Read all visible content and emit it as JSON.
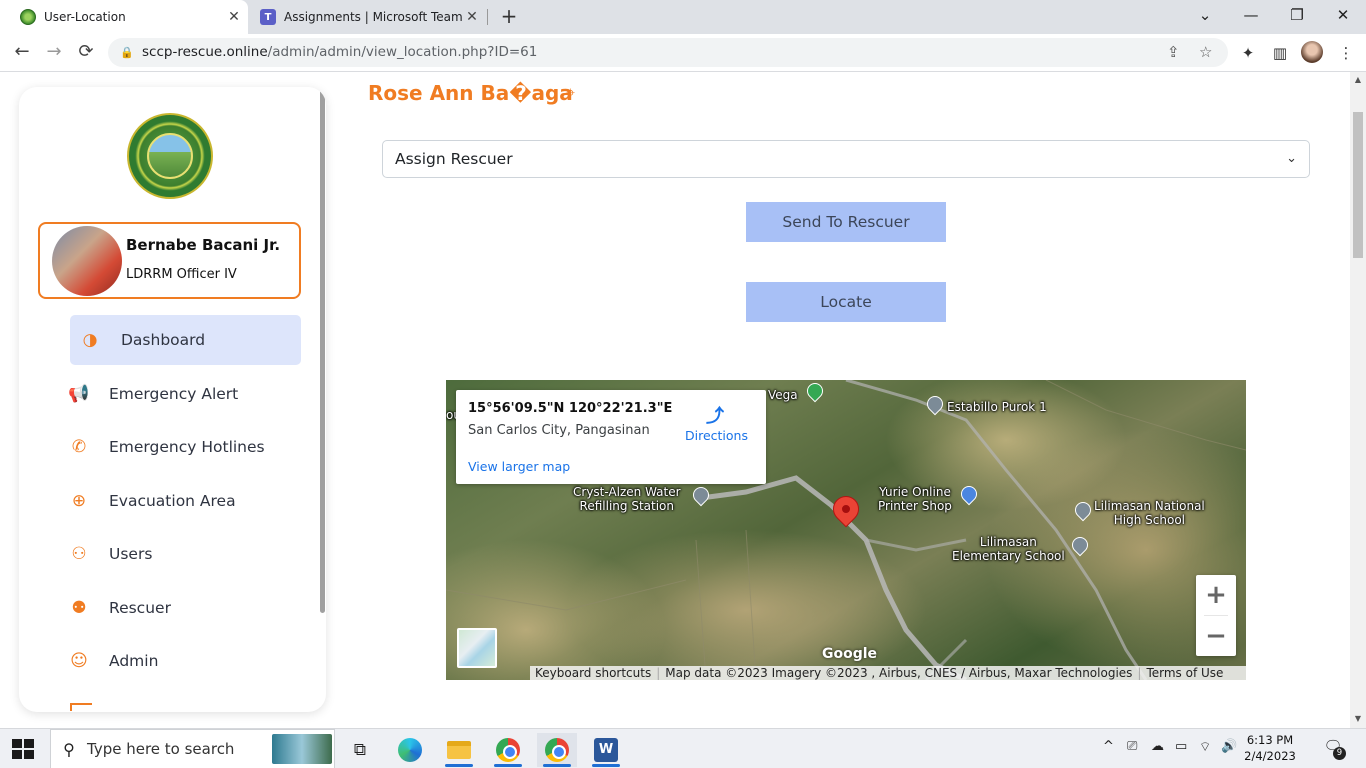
{
  "browser": {
    "tabs": [
      {
        "title": "User-Location",
        "close": "✕"
      },
      {
        "title": "Assignments | Microsoft Teams",
        "close": "✕",
        "icon_text": "T"
      }
    ],
    "new_tab": "+",
    "window_controls": {
      "minimize": "—",
      "maximize": "❐",
      "close": "✕",
      "tab_search": "⌄"
    },
    "nav": {
      "back": "←",
      "forward": "→",
      "reload": "⟳"
    },
    "url_host": "sccp-rescue.online",
    "url_path": "/admin/admin/view_location.php?ID=61",
    "lock": "🔒",
    "omnibox_icons": {
      "share": "⇪",
      "bookmark": "☆"
    },
    "extension_icons": {
      "extensions": "✦",
      "sidebar": "▥",
      "menu": "⋮"
    }
  },
  "sidebar": {
    "profile": {
      "name": "Bernabe Bacani Jr.",
      "role": "LDRRM Officer IV"
    },
    "items": [
      {
        "label": "Dashboard",
        "icon": "◑"
      },
      {
        "label": "Emergency Alert",
        "icon": "📢"
      },
      {
        "label": "Emergency Hotlines",
        "icon": "✆"
      },
      {
        "label": "Evacuation Area",
        "icon": "⊕"
      },
      {
        "label": "Users",
        "icon": "⚇"
      },
      {
        "label": "Rescuer",
        "icon": "⚉"
      },
      {
        "label": "Admin",
        "icon": "☺"
      }
    ]
  },
  "main": {
    "title": "Rose Ann Ba�aga",
    "title_icon": "⌖",
    "assign_select": {
      "value": "Assign Rescuer",
      "chevron": "⌄"
    },
    "send_button": "Send To Rescuer",
    "locate_button": "Locate"
  },
  "map": {
    "info": {
      "coords": "15°56'09.5\"N 120°22'21.3\"E",
      "place": "San Carlos City, Pangasinan",
      "directions": "Directions",
      "directions_icon": "⤴",
      "larger_map": "View larger map"
    },
    "labels": {
      "vega": "Vega",
      "estabillo": "Estabillo Purok 1",
      "cryst_line1": "Cryst-Alzen Water",
      "cryst_line2": "Refilling Station",
      "yurie_line1": "Yurie Online",
      "yurie_line2": "Printer Shop",
      "lilimasan_nhs_line1": "Lilimasan National",
      "lilimasan_nhs_line2": "High School",
      "lilimasan_es_line1": "Lilimasan",
      "lilimasan_es_line2": "Elementary School",
      "edge_fragment": "ou"
    },
    "zoom_in": "+",
    "zoom_out": "−",
    "google": "Google",
    "attribution": {
      "shortcuts": "Keyboard shortcuts",
      "data": "Map data ©2023 Imagery ©2023 , Airbus, CNES / Airbus, Maxar Technologies",
      "terms": "Terms of Use"
    }
  },
  "taskbar": {
    "search_placeholder": "Type here to search",
    "search_icon": "⚲",
    "taskview_icon": "⧉",
    "word_letter": "W",
    "tray_icons": {
      "chevron": "^",
      "meet": "⎚",
      "cloud": "☁",
      "battery": "▭",
      "wifi": "⌔",
      "volume": "🔊"
    },
    "time": "6:13 PM",
    "date": "2/4/2023",
    "notifications": "9",
    "notification_icon": "🗨"
  }
}
